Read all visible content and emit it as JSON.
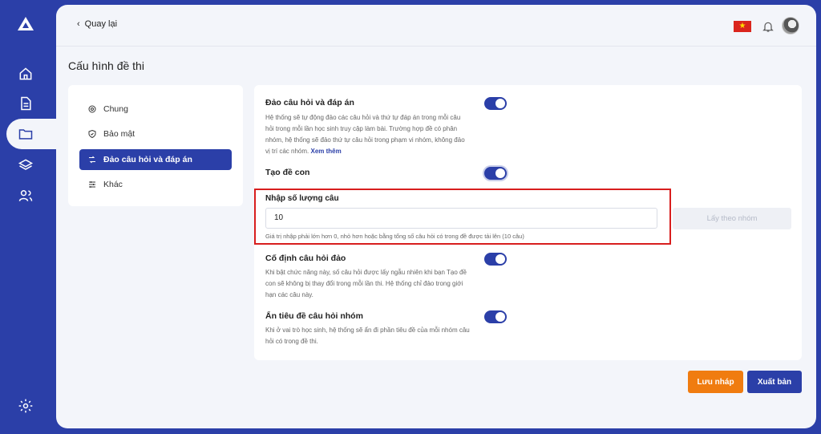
{
  "colors": {
    "brand": "#2b3fa8",
    "accent_orange": "#f07c10",
    "highlight_red": "#d81e1e"
  },
  "rail": {
    "logo_icon": "triangle-logo-icon",
    "items": [
      {
        "icon": "home-icon"
      },
      {
        "icon": "document-icon"
      },
      {
        "icon": "folder-icon",
        "active": true
      },
      {
        "icon": "layers-icon"
      },
      {
        "icon": "users-icon"
      }
    ],
    "bottom_icon": "gear-icon"
  },
  "header": {
    "back_label": "Quay lại",
    "language_flag": "vietnam-flag",
    "notification_icon": "bell-icon"
  },
  "page": {
    "title": "Cấu hình đề thi"
  },
  "menu": {
    "items": [
      {
        "label": "Chung",
        "icon": "gear-icon"
      },
      {
        "label": "Bảo mật",
        "icon": "shield-icon"
      },
      {
        "label": "Đảo câu hỏi và đáp án",
        "icon": "shuffle-icon",
        "active": true
      },
      {
        "label": "Khác",
        "icon": "sliders-icon"
      }
    ]
  },
  "settings": {
    "shuffle": {
      "title": "Đảo câu hỏi và đáp án",
      "desc": "Hệ thống sẽ tự động đảo các câu hỏi và thứ tự đáp án trong mỗi câu hỏi trong mỗi lần học sinh truy cập làm bài. Trường hợp đề có phân nhóm, hệ thống sẽ đảo thứ tự câu hỏi trong phạm vi nhóm, không đảo vị trí các nhóm.",
      "more_link": "Xem thêm",
      "enabled": true
    },
    "subtest": {
      "title": "Tạo đề con",
      "enabled": true
    },
    "question_count": {
      "label": "Nhập số lượng câu",
      "value": "10",
      "help": "Giá trị nhập phải lớn hơn 0, nhỏ hơn hoặc bằng tổng số câu hỏi có trong đề được tải lên (10 câu)",
      "group_button": "Lấy theo nhóm"
    },
    "fixed": {
      "title": "Cố định câu hỏi đảo",
      "desc": "Khi bật chức năng này, số câu hỏi được lấy ngẫu nhiên khi bạn Tạo đề con sẽ không bị thay đổi trong mỗi lần thi. Hệ thống chỉ đảo trong giới hạn các câu này.",
      "enabled": true
    },
    "hide_group_title": {
      "title": "Ẩn tiêu đề câu hỏi nhóm",
      "desc": "Khi ở vai trò học sinh, hệ thống sẽ ẩn đi phần tiêu đề của mỗi nhóm câu hỏi có trong đề thi.",
      "enabled": true
    }
  },
  "actions": {
    "draft": "Lưu nháp",
    "publish": "Xuất bản"
  }
}
